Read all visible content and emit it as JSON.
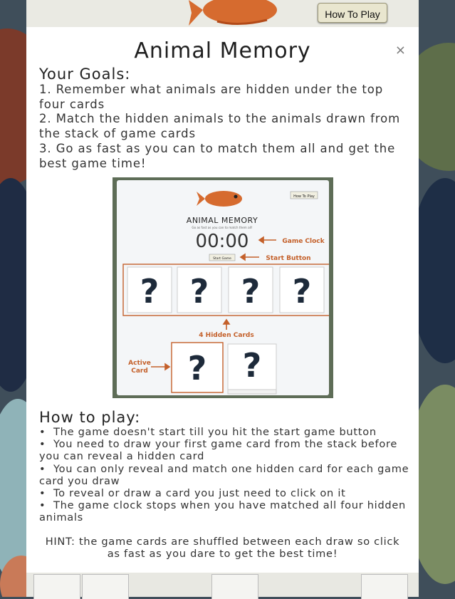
{
  "background": {
    "how_to_play_button": "How To Play"
  },
  "modal": {
    "title": "Animal Memory",
    "close_symbol": "×",
    "goals_heading": "Your Goals:",
    "goals": [
      "1. Remember what animals are hidden under the top four cards",
      "2. Match the hidden animals to the animals drawn from the stack of game cards",
      "3. Go as fast as you can to match them all and get the best game time!"
    ],
    "how_heading": "How to play:",
    "how_items": [
      "The game doesn't start till you hit the start game button",
      "You need to draw your first game card from the stack before you can reveal a hidden card",
      "You can only reveal and match one hidden card for each game card you draw",
      "To reveal or draw a card you just need to click on it",
      "The game clock stops when you have matched all four hidden animals"
    ],
    "hint": "HINT: the game cards are shuffled between each draw so click as fast as you dare to get the best time!"
  },
  "illustration": {
    "how_to_play_button": "How To Play",
    "title": "ANIMAL MEMORY",
    "subtitle": "Go as fast as you can to match them all!",
    "clock": "00:00",
    "start_button": "Start Game",
    "card_symbol": "?",
    "label_clock": "Game Clock",
    "label_start": "Start Button",
    "label_hidden": "4 Hidden Cards",
    "label_active": "Active Card",
    "accent": "#c4602a"
  }
}
